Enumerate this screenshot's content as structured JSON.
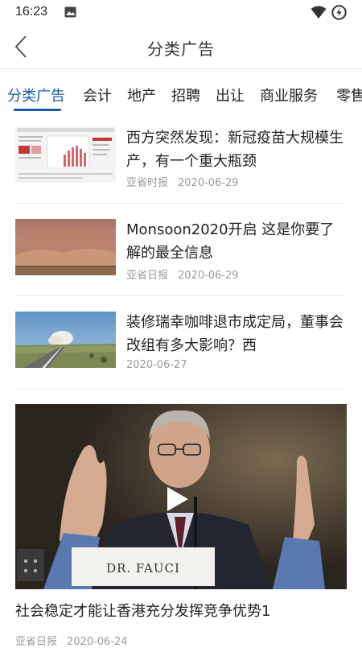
{
  "status_bar": {
    "time": "16:23"
  },
  "header": {
    "title": "分类广告"
  },
  "tabs": [
    {
      "label": "分类广告"
    },
    {
      "label": "会计"
    },
    {
      "label": "地产"
    },
    {
      "label": "招聘"
    },
    {
      "label": "出让"
    },
    {
      "label": "商业服务"
    },
    {
      "label": "零售"
    }
  ],
  "news": [
    {
      "title": "西方突然发现：新冠疫苗大规模生产，有一个重大瓶颈",
      "source": "亚省时报",
      "date": "2020-06-29"
    },
    {
      "title": "Monsoon2020开启 这是你要了解的最全信息",
      "source": "亚省日报",
      "date": "2020-06-29"
    },
    {
      "title": "装修瑞幸咖啡退市成定局，董事会改组有多大影响？西",
      "source": "",
      "date": "2020-06-27"
    }
  ],
  "video": {
    "nameplate": "DR. FAUCI",
    "title": "社会稳定才能让香港充分发挥竞争优势1",
    "source": "亚省日报",
    "date": "2020-06-24"
  },
  "colors": {
    "accent": "#1a5aa8",
    "meta_text": "#9a9a9a"
  }
}
